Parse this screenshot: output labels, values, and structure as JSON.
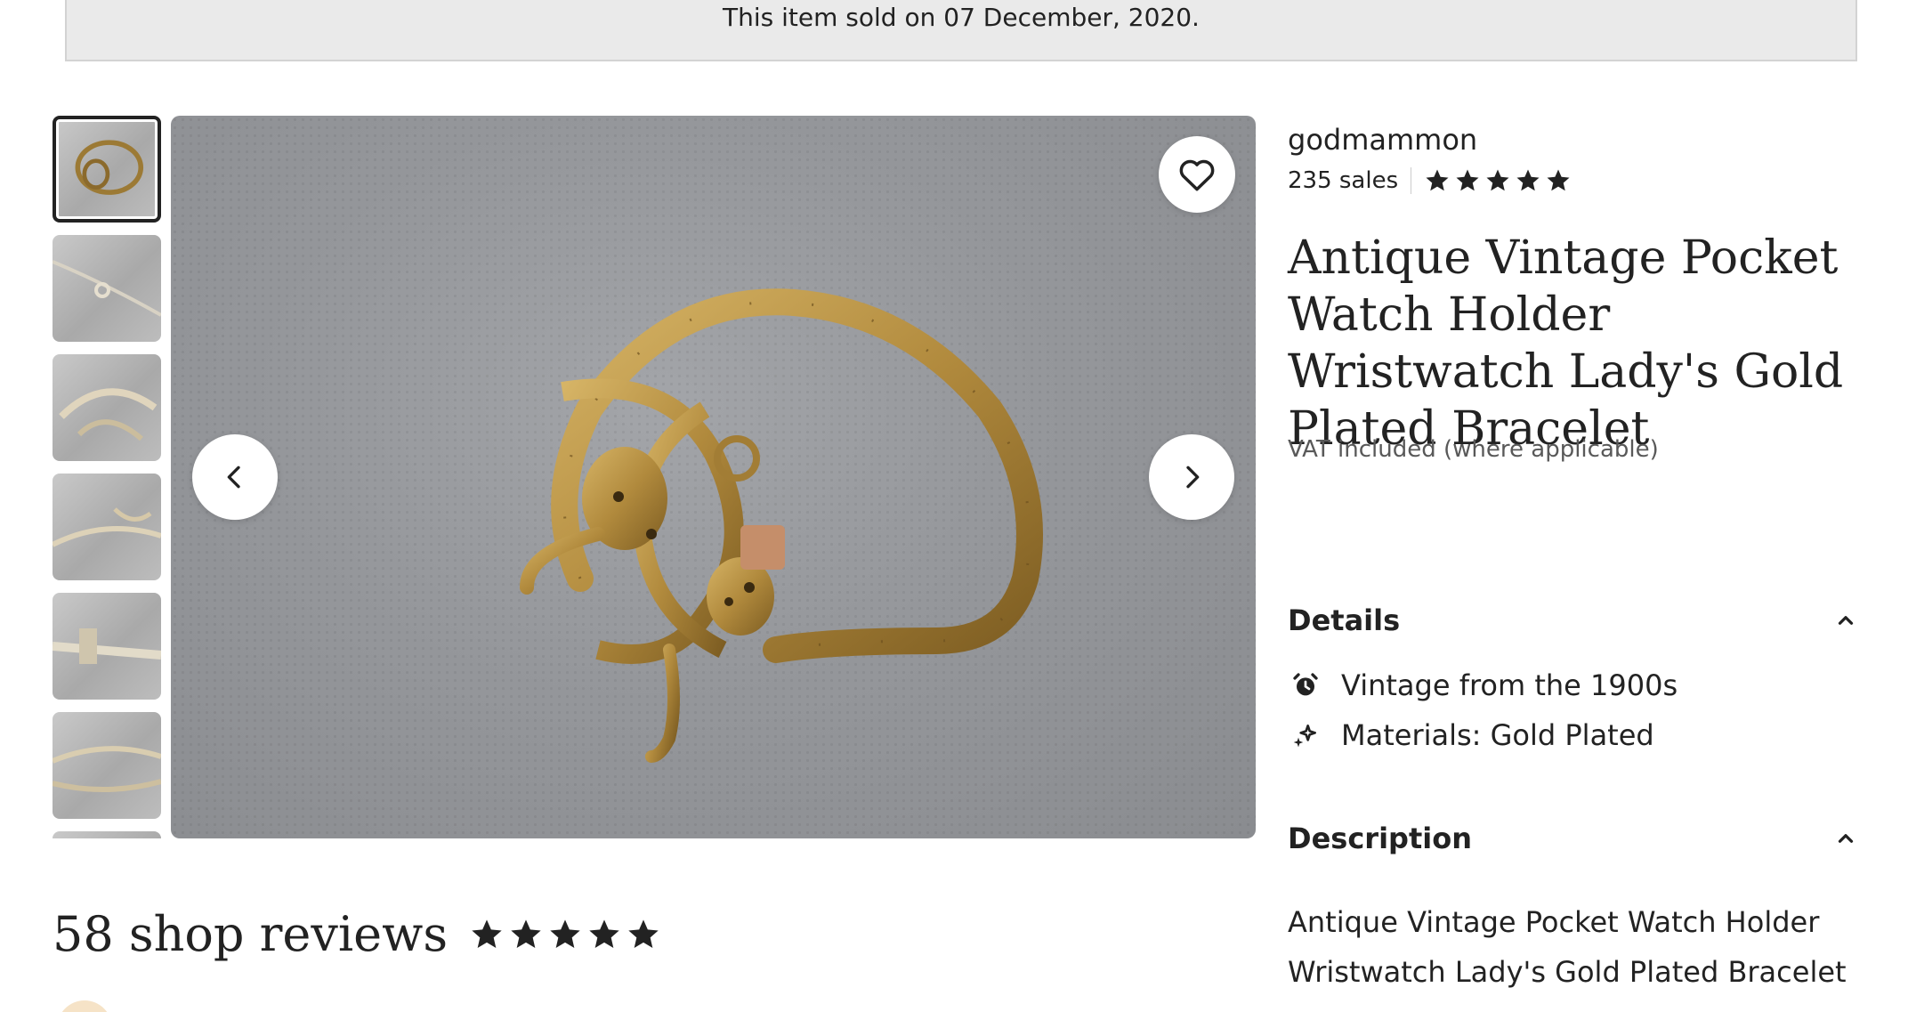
{
  "banner": {
    "sold_text": "This item sold on 07 December, 2020."
  },
  "shop": {
    "name": "godmammon",
    "sales": "235 sales",
    "rating_stars": 5
  },
  "listing": {
    "title": "Antique Vintage Pocket Watch Holder Wristwatch Lady's Gold Plated Bracelet",
    "vat_note": "VAT included (where applicable)"
  },
  "details": {
    "heading": "Details",
    "items": [
      {
        "icon": "alarm-clock-icon",
        "text": "Vintage from the 1900s"
      },
      {
        "icon": "sparkle-icon",
        "text": "Materials: Gold Plated"
      }
    ]
  },
  "description": {
    "heading": "Description",
    "text": "Antique Vintage Pocket Watch Holder Wristwatch Lady's Gold Plated Bracelet"
  },
  "reviews": {
    "label": "58 shop reviews",
    "rating_stars": 5
  },
  "gallery": {
    "thumbnail_count": 7,
    "active_index": 0
  },
  "colors": {
    "text": "#222222",
    "banner_bg": "#eaeaea",
    "muted": "#595959",
    "gold": "#b8913f"
  }
}
